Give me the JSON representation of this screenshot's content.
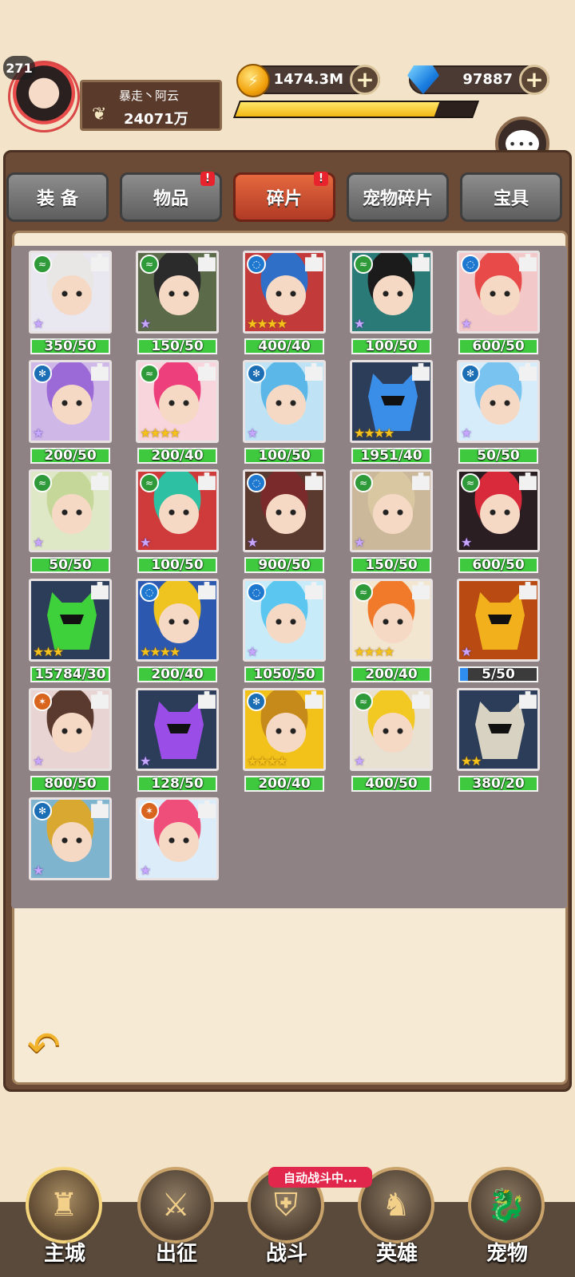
{
  "player": {
    "level": "271",
    "name": "暴走丶阿云",
    "power": "24071万"
  },
  "resources": {
    "gold": "1474.3M",
    "gems": "97887",
    "exp_fraction": 0.84
  },
  "chat": {
    "label": "聊天"
  },
  "tabs": [
    {
      "label": "装 备",
      "active": false,
      "badge": false
    },
    {
      "label": "物品",
      "active": false,
      "badge": true
    },
    {
      "label": "碎片",
      "active": true,
      "badge": true
    },
    {
      "label": "宠物碎片",
      "active": false,
      "badge": false
    },
    {
      "label": "宝具",
      "active": false,
      "badge": false
    }
  ],
  "badge_mark": "!",
  "fragments": [
    {
      "name": "silver-haired-girl",
      "count": "350/50",
      "stars": 1,
      "star_color": "purple",
      "element": "wind",
      "bg": "#e9e7f0",
      "hair": "#e9e6e6"
    },
    {
      "name": "cat-pirate",
      "count": "150/50",
      "stars": 1,
      "star_color": "purple",
      "element": "wind",
      "bg": "#5b6b4a",
      "hair": "#2b2b2b"
    },
    {
      "name": "blue-beetle",
      "count": "400/40",
      "stars": 4,
      "star_color": "gold",
      "element": "water",
      "bg": "#c33a3a",
      "hair": "#2f6fc8"
    },
    {
      "name": "goggle-rogue",
      "count": "100/50",
      "stars": 1,
      "star_color": "purple",
      "element": "wind",
      "bg": "#2a7a78",
      "hair": "#1b1b1b"
    },
    {
      "name": "red-haired-scholar",
      "count": "600/50",
      "stars": 1,
      "star_color": "purple",
      "element": "water",
      "bg": "#f3c8c8",
      "hair": "#e84a4a"
    },
    {
      "name": "purple-haired-girl",
      "count": "200/50",
      "stars": 1,
      "star_color": "purple",
      "element": "ice",
      "bg": "#cfb8e8",
      "hair": "#9b6ad6"
    },
    {
      "name": "pink-haired-girl",
      "count": "200/40",
      "stars": 4,
      "star_color": "gold",
      "element": "wind",
      "bg": "#f8d4dc",
      "hair": "#ec3f7b"
    },
    {
      "name": "blue-haired-mage",
      "count": "100/50",
      "stars": 1,
      "star_color": "purple",
      "element": "ice",
      "bg": "#bfe3f5",
      "hair": "#5bb7e8"
    },
    {
      "name": "blue-helmet",
      "count": "1951/40",
      "stars": 4,
      "star_color": "gold",
      "element": "none",
      "bg": "#2c3d5a",
      "hair": "helmet:#3a8ee8"
    },
    {
      "name": "light-blue-girl",
      "count": "50/50",
      "stars": 1,
      "star_color": "purple",
      "element": "ice",
      "bg": "#d6ecfa",
      "hair": "#78c3f0"
    },
    {
      "name": "blonde-elf",
      "count": "50/50",
      "stars": 1,
      "star_color": "purple",
      "element": "wind",
      "bg": "#dfe8c6",
      "hair": "#c5d89a"
    },
    {
      "name": "teal-haired-fighter",
      "count": "100/50",
      "stars": 1,
      "star_color": "purple",
      "element": "wind",
      "bg": "#cf3a3a",
      "hair": "#2ec0a2"
    },
    {
      "name": "dark-gunner",
      "count": "900/50",
      "stars": 1,
      "star_color": "purple",
      "element": "water",
      "bg": "#5a3a2e",
      "hair": "#7a2a2a"
    },
    {
      "name": "beast-girl",
      "count": "150/50",
      "stars": 1,
      "star_color": "purple",
      "element": "wind",
      "bg": "#cbb89a",
      "hair": "#d8c7a0"
    },
    {
      "name": "red-demon",
      "count": "600/50",
      "stars": 1,
      "star_color": "purple",
      "element": "wind",
      "bg": "#2b1e22",
      "hair": "#d82a3a"
    },
    {
      "name": "green-helmet",
      "count": "15784/30",
      "stars": 3,
      "star_color": "gold",
      "element": "none",
      "bg": "#2c3d5a",
      "hair": "helmet:#3fd13b"
    },
    {
      "name": "pirate-captain",
      "count": "200/40",
      "stars": 4,
      "star_color": "gold",
      "element": "water",
      "bg": "#2d58b0",
      "hair": "#f0c420"
    },
    {
      "name": "water-maiden",
      "count": "1050/50",
      "stars": 1,
      "star_color": "purple",
      "element": "water",
      "bg": "#c7ebf8",
      "hair": "#5bc6f0"
    },
    {
      "name": "orange-elf",
      "count": "200/40",
      "stars": 4,
      "star_color": "gold",
      "element": "wind",
      "bg": "#f3e6d0",
      "hair": "#f07a2a"
    },
    {
      "name": "gold-helmet",
      "count": "5/50",
      "stars": 1,
      "star_color": "purple",
      "element": "none",
      "bg": "#b84a12",
      "hair": "helmet:#f2b01c",
      "progress": 0.1
    },
    {
      "name": "brown-haired-girl",
      "count": "800/50",
      "stars": 1,
      "star_color": "purple",
      "element": "fire",
      "bg": "#e9d4d4",
      "hair": "#5a3a2e"
    },
    {
      "name": "purple-helmet",
      "count": "128/50",
      "stars": 1,
      "star_color": "purple",
      "element": "none",
      "bg": "#2c3d5a",
      "hair": "helmet:#9b4de8"
    },
    {
      "name": "golden-beast",
      "count": "200/40",
      "stars": 4,
      "star_color": "gold",
      "element": "ice",
      "bg": "#f2c21a",
      "hair": "#c58a1a"
    },
    {
      "name": "blonde-warrior",
      "count": "400/50",
      "stars": 1,
      "star_color": "purple",
      "element": "wind",
      "bg": "#e8e0d0",
      "hair": "#f2c823"
    },
    {
      "name": "silver-helmet",
      "count": "380/20",
      "stars": 2,
      "star_color": "gold",
      "element": "none",
      "bg": "#2c3d5a",
      "hair": "helmet:#d8d2c2"
    },
    {
      "name": "golden-knight",
      "count": "",
      "stars": 1,
      "star_color": "purple",
      "element": "ice",
      "bg": "#7fb4cf",
      "hair": "#d9a830"
    },
    {
      "name": "pink-haired-hero",
      "count": "",
      "stars": 1,
      "star_color": "purple",
      "element": "fire",
      "bg": "#dcecf8",
      "hair": "#f04e7a"
    }
  ],
  "element_colors": {
    "wind": "#2f9a3a",
    "water": "#1f78d0",
    "ice": "#1d6fb5",
    "fire": "#d8641e"
  },
  "element_glyphs": {
    "wind": "≈",
    "water": "◌",
    "ice": "✻",
    "fire": "✶"
  },
  "auto_battle": "自动战斗中...",
  "nav": [
    {
      "label": "主城",
      "icon": "castle-icon",
      "glyph": "♜",
      "active": true
    },
    {
      "label": "出征",
      "icon": "crossed-swords-icon",
      "glyph": "⚔",
      "active": false
    },
    {
      "label": "战斗",
      "icon": "battle-shield-icon",
      "glyph": "⛨",
      "active": false
    },
    {
      "label": "英雄",
      "icon": "hooded-hero-icon",
      "glyph": "♞",
      "active": false
    },
    {
      "label": "宠物",
      "icon": "pet-dragon-icon",
      "glyph": "🐉",
      "active": false
    }
  ]
}
